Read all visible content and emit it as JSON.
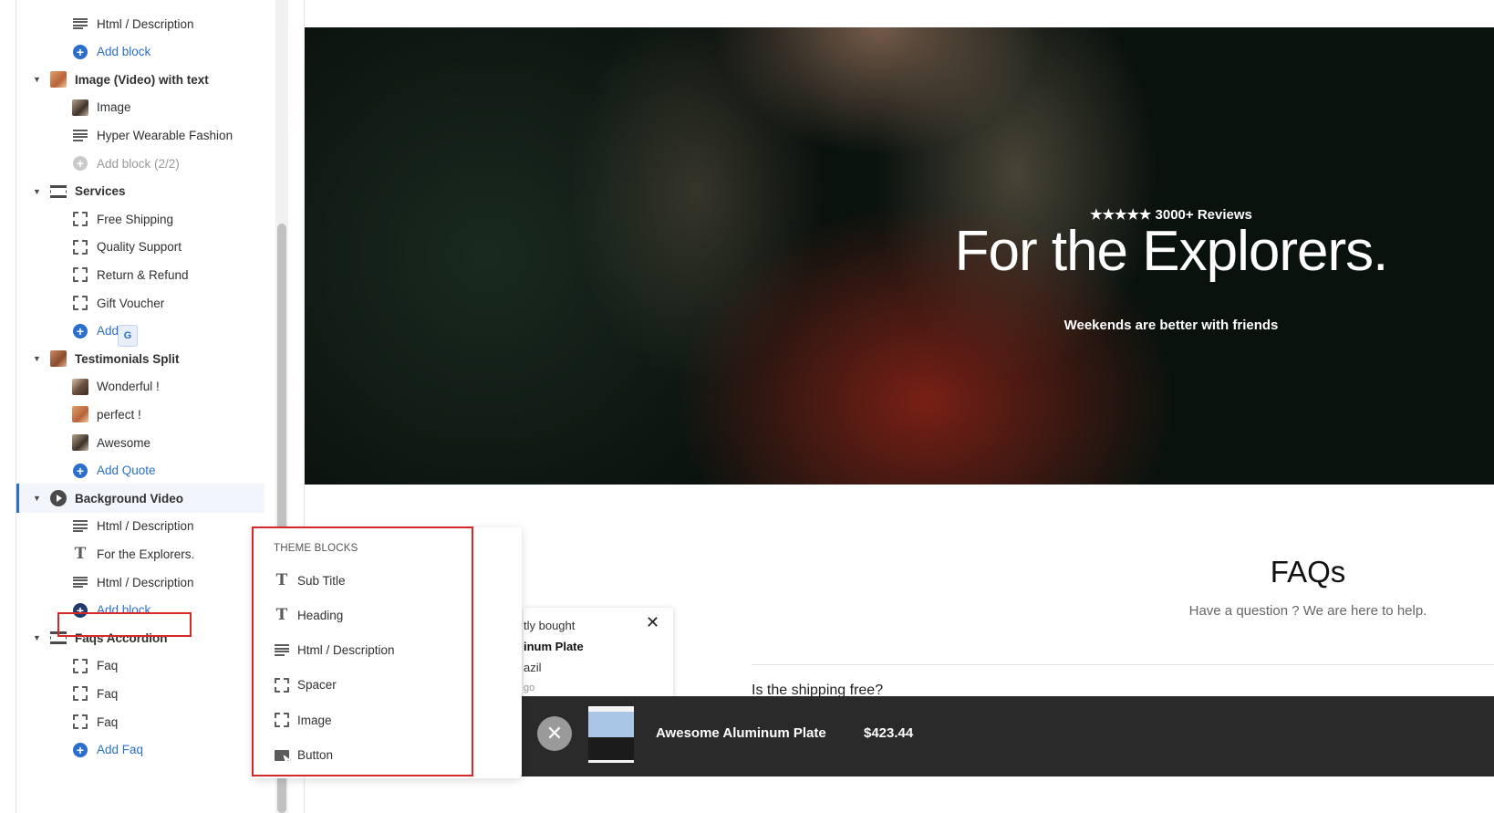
{
  "sidebar": {
    "rows": [
      {
        "type": "child",
        "icon": "lines-icon",
        "label": "Html / Description"
      },
      {
        "type": "add",
        "icon": "plus-circle-icon",
        "label": "Add block"
      },
      {
        "type": "section",
        "icon": "image-thumbnail-icon",
        "label": "Image (Video) with text"
      },
      {
        "type": "child",
        "icon": "image-thumbnail-icon",
        "label": "Image"
      },
      {
        "type": "child",
        "icon": "lines-icon",
        "label": "Hyper Wearable Fashion"
      },
      {
        "type": "add-disabled",
        "icon": "plus-circle-icon",
        "label": "Add block (2/2)"
      },
      {
        "type": "section",
        "icon": "section-icon",
        "label": "Services"
      },
      {
        "type": "child",
        "icon": "dashed-box-icon",
        "label": "Free Shipping"
      },
      {
        "type": "child",
        "icon": "dashed-box-icon",
        "label": "Quality Support"
      },
      {
        "type": "child",
        "icon": "dashed-box-icon",
        "label": "Return & Refund"
      },
      {
        "type": "child",
        "icon": "dashed-box-icon",
        "label": "Gift Voucher"
      },
      {
        "type": "add",
        "icon": "plus-circle-icon",
        "label": "Add        ice"
      },
      {
        "type": "section",
        "icon": "image-thumbnail-icon",
        "label": "Testimonials Split"
      },
      {
        "type": "child",
        "icon": "image-thumbnail-icon",
        "label": "Wonderful !"
      },
      {
        "type": "child",
        "icon": "image-thumbnail-icon",
        "label": "perfect !"
      },
      {
        "type": "child",
        "icon": "image-thumbnail-icon",
        "label": "Awesome"
      },
      {
        "type": "add",
        "icon": "plus-circle-icon",
        "label": "Add Quote"
      },
      {
        "type": "section-active",
        "icon": "play-icon",
        "label": "Background Video"
      },
      {
        "type": "child",
        "icon": "lines-icon",
        "label": "Html / Description"
      },
      {
        "type": "child",
        "icon": "text-T-icon",
        "label": "For the Explorers."
      },
      {
        "type": "child",
        "icon": "lines-icon",
        "label": "Html / Description"
      },
      {
        "type": "add-active",
        "icon": "plus-circle-icon",
        "label": "Add block"
      },
      {
        "type": "section",
        "icon": "section-icon",
        "label": "Faqs Accordion"
      },
      {
        "type": "child",
        "icon": "dashed-box-icon",
        "label": "Faq"
      },
      {
        "type": "child",
        "icon": "dashed-box-icon",
        "label": "Faq"
      },
      {
        "type": "child",
        "icon": "dashed-box-icon",
        "label": "Faq"
      },
      {
        "type": "add",
        "icon": "plus-circle-icon",
        "label": "Add Faq"
      }
    ]
  },
  "popover": {
    "heading": "THEME BLOCKS",
    "items": [
      {
        "icon": "text-T-icon",
        "label": "Sub Title"
      },
      {
        "icon": "text-T-icon",
        "label": "Heading"
      },
      {
        "icon": "lines-icon",
        "label": "Html / Description"
      },
      {
        "icon": "dashed-box-icon",
        "label": "Spacer"
      },
      {
        "icon": "dashed-box-icon",
        "label": "Image"
      },
      {
        "icon": "button-cursor-icon",
        "label": "Button"
      }
    ]
  },
  "hero": {
    "reviews": "★★★★★ 3000+ Reviews",
    "title": "For the Explorers.",
    "subtitle": "Weekends are better with friends"
  },
  "faq": {
    "title": "FAQs",
    "subtitle": "Have a question ? We are here to help.",
    "first_question": "Is the shipping free?"
  },
  "recent_popup": {
    "line1": "tly bought",
    "line2": "inum Plate",
    "line3": "azil",
    "line4": "go"
  },
  "sticky_bar": {
    "product_name": "Awesome Aluminum Plate",
    "price": "$423.44"
  },
  "translate_badge": "G"
}
